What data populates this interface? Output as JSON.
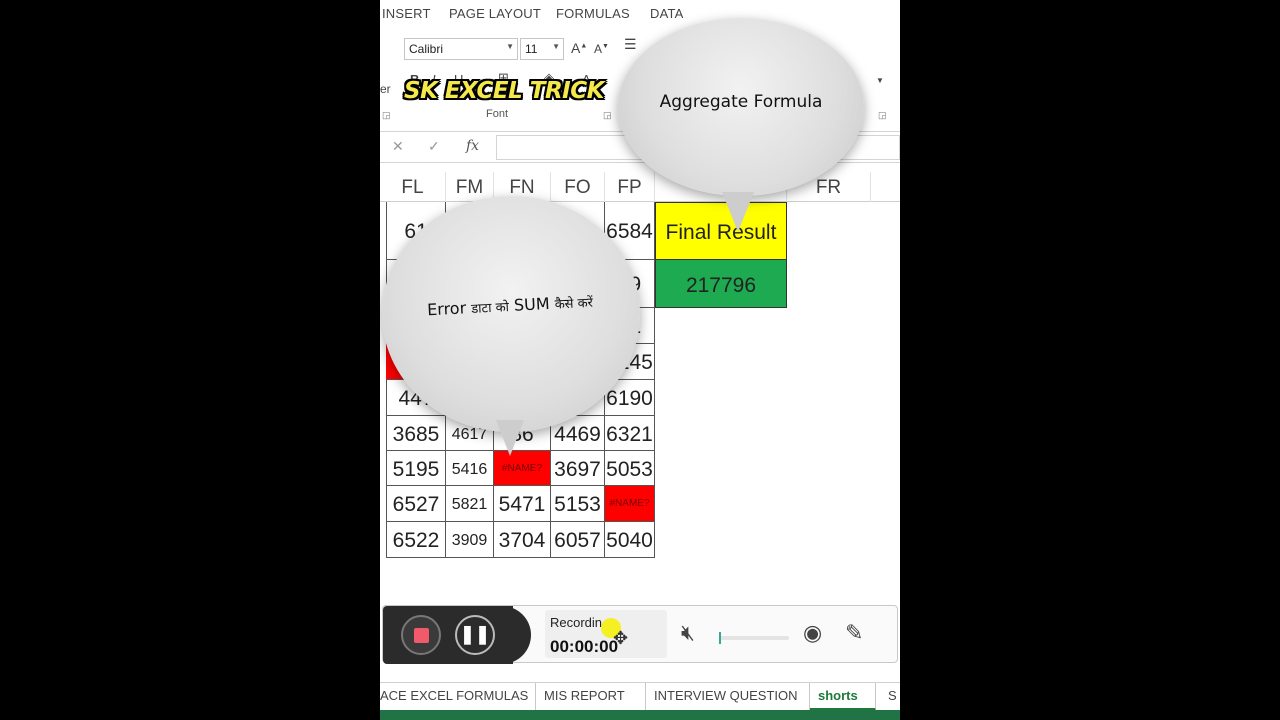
{
  "ribbon": {
    "tabs": [
      "INSERT",
      "PAGE LAYOUT",
      "FORMULAS",
      "DATA"
    ],
    "font_name": "Calibri",
    "font_size": "11",
    "font_group_label": "Font"
  },
  "watermark": "SK EXCEL TRICK",
  "formula_bar": {
    "fx_label": "fx",
    "value": ""
  },
  "columns": [
    "FL",
    "FM",
    "FN",
    "FO",
    "FP",
    "FR"
  ],
  "grid": {
    "rows": [
      [
        "61",
        "",
        "",
        "",
        "6584"
      ],
      [
        "",
        "",
        "",
        "",
        "39"
      ],
      [
        "",
        "",
        "",
        "",
        "51"
      ],
      [
        "",
        "",
        "",
        "",
        "6245"
      ],
      [
        "447",
        "",
        "",
        "486",
        "6190"
      ],
      [
        "3685",
        "4617",
        "36",
        "4469",
        "6321"
      ],
      [
        "5195",
        "5416",
        "#NAME?",
        "3697",
        "5053"
      ],
      [
        "6527",
        "5821",
        "5471",
        "5153",
        "#NAME?"
      ],
      [
        "6522",
        "3909",
        "3704",
        "6057",
        "5040"
      ]
    ],
    "final_label": "Final Result",
    "final_value": "217796"
  },
  "bubbles": {
    "top": "Aggregate Formula",
    "left_prefix": "Error",
    "left_hindi_1": "डाटा को",
    "left_mid": "SUM",
    "left_hindi_2": "कैसे करें"
  },
  "recorder": {
    "status": "Recordin",
    "time": "00:00:00"
  },
  "sheet_tabs": [
    "ACE EXCEL FORMULAS",
    "MIS REPORT",
    "INTERVIEW QUESTION",
    "shorts",
    "S"
  ],
  "active_sheet": "shorts",
  "colors": {
    "final_label_bg": "#ffff00",
    "final_value_bg": "#1eaa50",
    "error_bg": "#ff0000",
    "watermark": "#f5e94a",
    "excel_green": "#217346"
  }
}
